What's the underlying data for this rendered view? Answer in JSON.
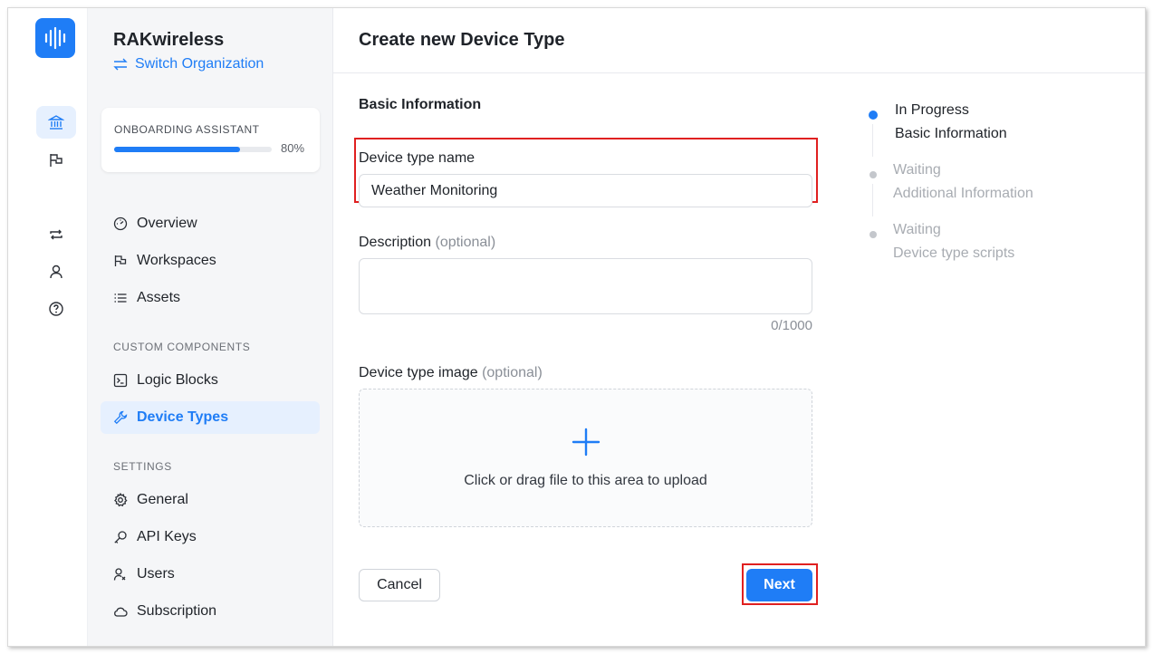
{
  "org": {
    "name": "RAKwireless",
    "switch_label": "Switch Organization"
  },
  "onboarding": {
    "title": "ONBOARDING ASSISTANT",
    "progress": 0.8,
    "percent_label": "80%"
  },
  "nav": {
    "main": [
      {
        "label": "Overview",
        "icon": "dashboard-icon"
      },
      {
        "label": "Workspaces",
        "icon": "flag-icon"
      },
      {
        "label": "Assets",
        "icon": "list-icon"
      }
    ],
    "custom_components_label": "CUSTOM COMPONENTS",
    "custom": [
      {
        "label": "Logic Blocks",
        "icon": "terminal-icon"
      },
      {
        "label": "Device Types",
        "icon": "wrench-icon",
        "active": true
      }
    ],
    "settings_label": "SETTINGS",
    "settings": [
      {
        "label": "General",
        "icon": "gear-icon"
      },
      {
        "label": "API Keys",
        "icon": "key-icon"
      },
      {
        "label": "Users",
        "icon": "users-icon"
      },
      {
        "label": "Subscription",
        "icon": "cloud-icon"
      }
    ]
  },
  "page": {
    "title": "Create new Device Type"
  },
  "form": {
    "section_title": "Basic Information",
    "name_label": "Device type name",
    "name_value": "Weather Monitoring",
    "description_label": "Description",
    "description_optional": "(optional)",
    "description_counter": "0/1000",
    "image_label": "Device type image",
    "image_optional": "(optional)",
    "upload_text": "Click or drag file to this area to upload",
    "cancel_label": "Cancel",
    "next_label": "Next"
  },
  "steps": [
    {
      "status": "In Progress",
      "name": "Basic Information",
      "state": "active"
    },
    {
      "status": "Waiting",
      "name": "Additional Information",
      "state": "waiting"
    },
    {
      "status": "Waiting",
      "name": "Device type scripts",
      "state": "waiting"
    }
  ],
  "colors": {
    "accent": "#1f7df6",
    "highlight": "#e02020",
    "waiting": "#b8bcc2"
  }
}
